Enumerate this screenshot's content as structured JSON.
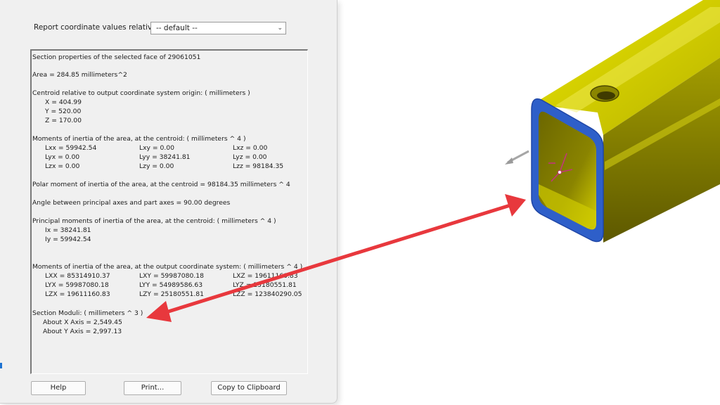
{
  "dialog": {
    "report_label": "Report coordinate values relative to:",
    "report_select_value": "-- default --"
  },
  "results": {
    "heading": "Section properties of the selected face of 29061051",
    "area": "Area = 284.85 millimeters^2",
    "centroid_heading": "Centroid relative to output coordinate system origin: ( millimeters )",
    "centroid": [
      "X = 404.99",
      "Y = 520.00",
      "Z = 170.00"
    ],
    "moments_heading": "Moments of inertia of the area, at the centroid: ( millimeters ^ 4 )",
    "moments": [
      [
        "Lxx = 59942.54",
        "Lxy = 0.00",
        "Lxz = 0.00"
      ],
      [
        "Lyx = 0.00",
        "Lyy = 38241.81",
        "Lyz = 0.00"
      ],
      [
        "Lzx = 0.00",
        "Lzy = 0.00",
        "Lzz = 98184.35"
      ]
    ],
    "polar": "Polar moment of inertia of the area, at the centroid = 98184.35 millimeters ^ 4",
    "angle": "Angle between principal axes and part axes = 90.00 degrees",
    "principal_heading": "Principal moments of inertia of the area, at the centroid: ( millimeters ^ 4 )",
    "principal": [
      "Ix = 38241.81",
      "Iy = 59942.54"
    ],
    "output_heading": "Moments of inertia of the area, at the output coordinate system: ( millimeters ^ 4 )",
    "output": [
      [
        "LXX = 85314910.37",
        "LXY = 59987080.18",
        "LXZ = 19611160.83"
      ],
      [
        "LYX = 59987080.18",
        "LYY = 54989586.63",
        "LYZ = 25180551.81"
      ],
      [
        "LZX = 19611160.83",
        "LZY = 25180551.81",
        "LZZ = 123840290.05"
      ]
    ],
    "moduli_heading": "Section Moduli: ( millimeters ^ 3 )",
    "moduli": [
      "About X Axis = 2,549.45",
      "About Y Axis = 2,997.13"
    ]
  },
  "buttons": {
    "help": "Help",
    "print": "Print...",
    "copy": "Copy to Clipboard"
  },
  "colors": {
    "annotation_arrow": "#e8383d",
    "tube_yellow": "#d8d400",
    "selected_face_blue": "#2e5fc9"
  }
}
